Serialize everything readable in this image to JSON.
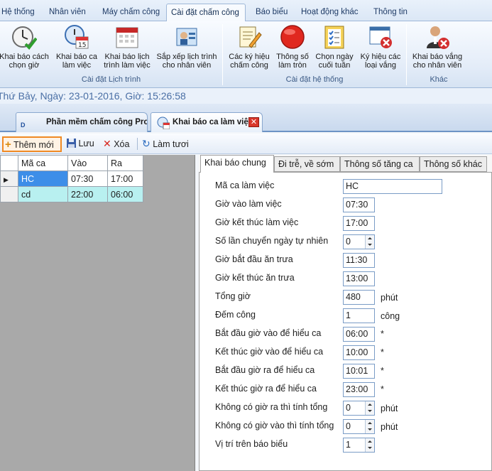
{
  "ribbon_tabs": [
    "Hệ thống",
    "Nhân viên",
    "Máy chấm công",
    "Cài đặt chấm công",
    "Báo biểu",
    "Hoạt động khác",
    "Thông tin"
  ],
  "ribbon": {
    "buttons": [
      {
        "line1": "Khai báo cách",
        "line2": "chọn giờ",
        "icon": "clock-check-icon"
      },
      {
        "line1": "Khai báo ca",
        "line2": "làm việc",
        "icon": "clock-calendar-icon"
      },
      {
        "line1": "Khai báo lịch",
        "line2": "trình làm việc",
        "icon": "calendar-icon"
      },
      {
        "line1": "Sắp xếp lịch trình",
        "line2": "cho nhân viên",
        "icon": "user-schedule-icon"
      },
      {
        "line1": "Các ký hiệu",
        "line2": "chấm công",
        "icon": "notepad-pencil-icon"
      },
      {
        "line1": "Thông số",
        "line2": "làm tròn",
        "icon": "red-circle-icon"
      },
      {
        "line1": "Chọn ngày",
        "line2": "cuối tuần",
        "icon": "checklist-icon"
      },
      {
        "line1": "Ký hiệu các",
        "line2": "loại vắng",
        "icon": "window-delete-icon"
      },
      {
        "line1": "Khai báo vắng",
        "line2": "cho nhân viên",
        "icon": "user-delete-icon"
      }
    ],
    "groups": [
      "Cài đặt Lịch trình",
      "Cài đặt hệ thống",
      "Khác"
    ]
  },
  "date_line": "Thứ Bảy, Ngày: 23-01-2016, Giờ: 15:26:58",
  "doc_tabs": [
    "Phần mềm chấm công Pro",
    "Khai báo ca làm việc"
  ],
  "toolbar": {
    "add": "Thêm mới",
    "save": "Lưu",
    "delete": "Xóa",
    "refresh": "Làm tươi"
  },
  "grid": {
    "columns": [
      "Mã ca",
      "Vào",
      "Ra"
    ],
    "rows": [
      {
        "ma": "HC",
        "vao": "07:30",
        "ra": "17:00"
      },
      {
        "ma": "cd",
        "vao": "22:00",
        "ra": "06:00"
      }
    ]
  },
  "panel_tabs": [
    "Khai báo chung",
    "Đi trễ, về sớm",
    "Thông số tăng ca",
    "Thông số khác"
  ],
  "form": {
    "ma_ca": {
      "label": "Mã ca làm việc",
      "value": "HC"
    },
    "gio_vao": {
      "label": "Giờ vào làm việc",
      "value": "07:30"
    },
    "gio_ket_thuc": {
      "label": "Giờ kết thúc làm việc",
      "value": "17:00"
    },
    "so_lan": {
      "label": "Số lần chuyển ngày tự nhiên",
      "value": "0"
    },
    "bat_dau_an": {
      "label": "Giờ bắt đầu ăn trưa",
      "value": "11:30"
    },
    "ket_thuc_an": {
      "label": "Giờ kết thúc ăn trưa",
      "value": "13:00"
    },
    "tong_gio": {
      "label": "Tổng giờ",
      "value": "480",
      "unit": "phút"
    },
    "dem_cong": {
      "label": "Đếm công",
      "value": "1",
      "unit": "công"
    },
    "bd_vao": {
      "label": "Bắt đầu giờ vào để hiểu ca",
      "value": "06:00",
      "mark": "*"
    },
    "kt_vao": {
      "label": "Kết thúc giờ vào để hiểu ca",
      "value": "10:00",
      "mark": "*"
    },
    "bd_ra": {
      "label": "Bắt đầu giờ ra để hiểu ca",
      "value": "10:01",
      "mark": "*"
    },
    "kt_ra": {
      "label": "Kết thúc giờ ra để hiểu ca",
      "value": "23:00",
      "mark": "*"
    },
    "khong_ra": {
      "label": "Không có giờ ra thì tính tổng",
      "value": "0",
      "unit": "phút"
    },
    "khong_vao": {
      "label": "Không có giờ vào thì tính tổng",
      "value": "0",
      "unit": "phút"
    },
    "vi_tri": {
      "label": "Vị trí trên báo biểu",
      "value": "1"
    }
  }
}
